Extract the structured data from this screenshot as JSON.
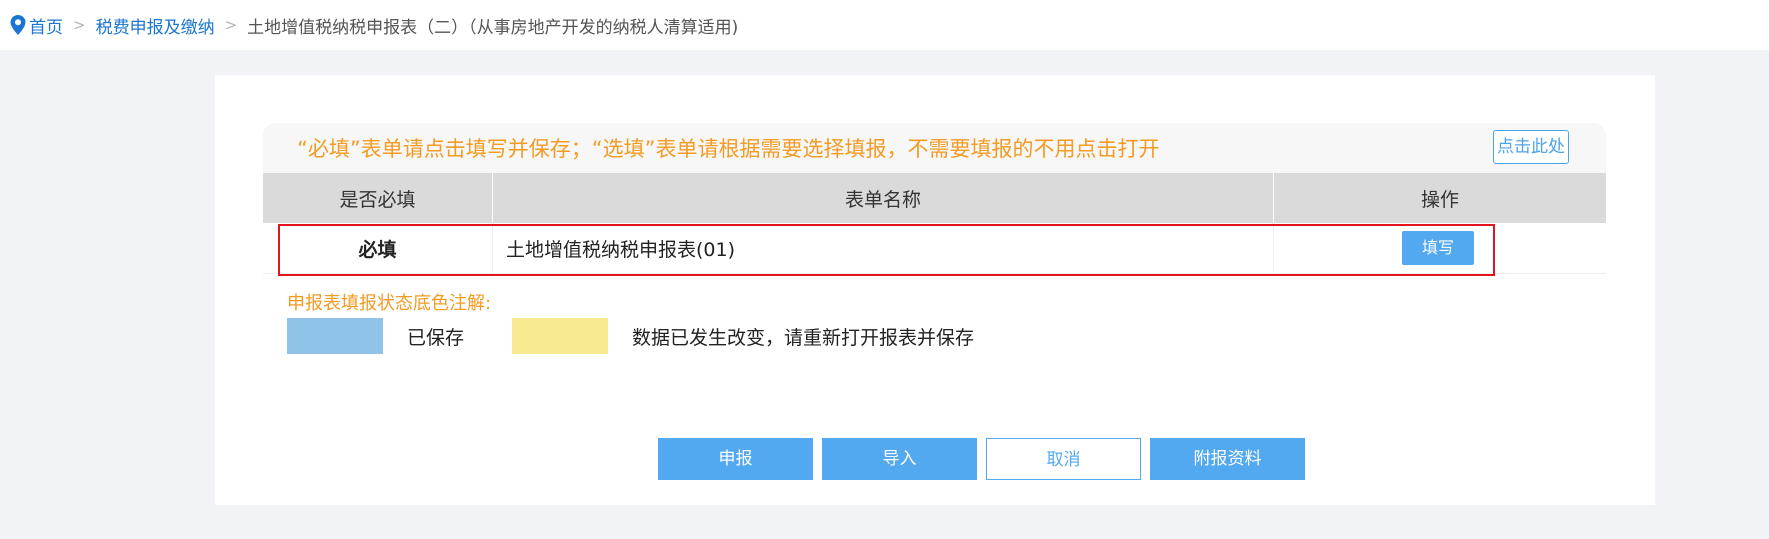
{
  "breadcrumb": {
    "home": "首页",
    "level2": "税费申报及缴纳",
    "current": "土地增值税纳税申报表（二）（从事房地产开发的纳税人清算适用)",
    "separator": ">"
  },
  "notice": {
    "text": "“必填”表单请点击填写并保存；“选填”表单请根据需要选择填报，不需要填报的不用点击打开",
    "button_label": "点击此处"
  },
  "table": {
    "headers": [
      "是否必填",
      "表单名称",
      "操作"
    ],
    "rows": [
      {
        "required": "必填",
        "name": "土地增值税纳税申报表(01)",
        "action": "填写"
      }
    ]
  },
  "legend": {
    "title": "申报表填报状态底色注解:",
    "saved_label": "已保存",
    "changed_label": "数据已发生改变，请重新打开报表并保存",
    "saved_color": "#8fc4e8",
    "changed_color": "#f7ea91"
  },
  "actions": {
    "submit": "申报",
    "import": "导入",
    "cancel": "取消",
    "attachments": "附报资料"
  },
  "colors": {
    "accent": "#52a9ef",
    "link": "#1a76d2",
    "warning": "#f39b23",
    "required": "#e2141d"
  }
}
